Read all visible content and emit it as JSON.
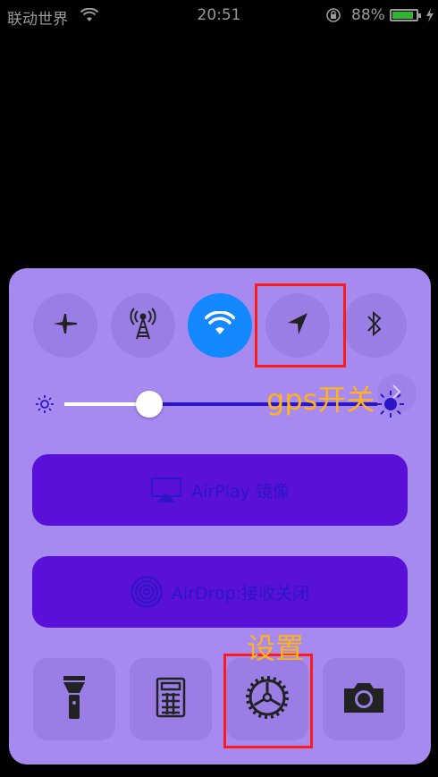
{
  "status_bar": {
    "carrier": "联动世界",
    "time": "20:51",
    "battery_percent": "88%",
    "battery_level": 0.88
  },
  "brightness": {
    "level": 0.27
  },
  "airplay": {
    "label": "AirPlay 镜像"
  },
  "airdrop": {
    "label": "AirDrop:接收关闭"
  },
  "annotations": {
    "gps_label": "gps开关",
    "settings_label": "设置"
  },
  "colors": {
    "accent": "#1488ff",
    "panel": "#a68af0",
    "annotation_box": "#ff1a1a",
    "annotation_text": "#ffb21a"
  }
}
